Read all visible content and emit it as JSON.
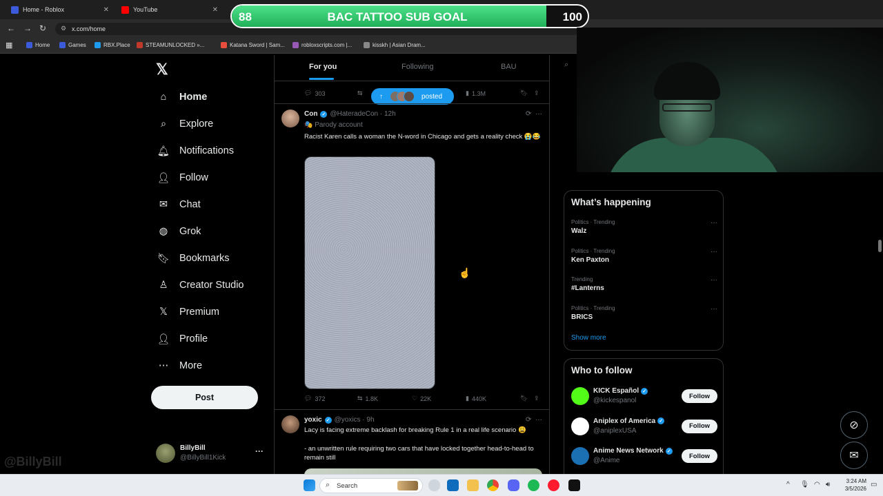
{
  "browser": {
    "tabs": [
      {
        "title": "Home - Roblox",
        "color": "#3b5bdb"
      },
      {
        "title": "YouTube",
        "color": "#ff0000"
      }
    ],
    "url": "x.com/home",
    "bookmarks": [
      {
        "label": "Home",
        "color": "#3b5bdb"
      },
      {
        "label": "Games",
        "color": "#3b5bdb"
      },
      {
        "label": "RBX.Place",
        "color": "#1d9bf0"
      },
      {
        "label": "STEAMUNLOCKED »...",
        "color": "#c0392b"
      },
      {
        "label": "Katana Sword | Sam...",
        "color": "#e74c3c"
      },
      {
        "label": "robloxscripts.com |...",
        "color": "#9b59b6"
      },
      {
        "label": "kisskh | Asian Dram...",
        "color": "#888888"
      }
    ]
  },
  "overlay": {
    "goal_current": "88",
    "goal_title": "BAC TATTOO SUB GOAL",
    "goal_target": "100",
    "goal_fraction": 0.88
  },
  "nav": {
    "items": [
      {
        "label": "Home",
        "icon": "home-icon",
        "glyph": "⌂"
      },
      {
        "label": "Explore",
        "icon": "search-icon",
        "glyph": "⌕"
      },
      {
        "label": "Notifications",
        "icon": "bell-icon",
        "glyph": "🔔︎"
      },
      {
        "label": "Follow",
        "icon": "person-plus-icon",
        "glyph": "👤︎"
      },
      {
        "label": "Chat",
        "icon": "mail-icon",
        "glyph": "✉"
      },
      {
        "label": "Grok",
        "icon": "grok-icon",
        "glyph": "◍"
      },
      {
        "label": "Bookmarks",
        "icon": "bookmark-icon",
        "glyph": "🔖︎"
      },
      {
        "label": "Creator Studio",
        "icon": "creator-icon",
        "glyph": "♙"
      },
      {
        "label": "Premium",
        "icon": "x-icon",
        "glyph": "𝕏"
      },
      {
        "label": "Profile",
        "icon": "profile-icon",
        "glyph": "👤︎"
      },
      {
        "label": "More",
        "icon": "more-circle-icon",
        "glyph": "⋯"
      }
    ],
    "post_label": "Post",
    "account_name": "BillyBill",
    "account_handle": "@BillyBill1Kick"
  },
  "timeline": {
    "tabs": [
      "For you",
      "Following",
      "BAU"
    ],
    "prev_stats": {
      "replies": "303",
      "views": "1.3M"
    },
    "posted_label": "posted",
    "tweets": [
      {
        "name": "Con",
        "handle": "@HateradeCon · 12h",
        "parody": "🎭 Parody account",
        "text": "Racist Karen calls a woman the N-word in Chicago and gets a reality check 😭😂",
        "replies": "372",
        "reposts": "1.8K",
        "likes": "22K",
        "views": "440K"
      },
      {
        "name": "yoxic",
        "handle": "@yoxics · 9h",
        "text": "Lacy is facing extreme backlash for breaking Rule 1 in a real life scenario 😩",
        "text2": "- an unwritten rule requiring two cars that have locked together head-to-head to remain still"
      }
    ]
  },
  "trending": {
    "title": "What’s happening",
    "items": [
      {
        "category": "Politics · Trending",
        "name": "Walz"
      },
      {
        "category": "Politics · Trending",
        "name": "Ken Paxton"
      },
      {
        "category": "Trending",
        "name": "#Lanterns"
      },
      {
        "category": "Politics · Trending",
        "name": "BRICS"
      }
    ],
    "show_more": "Show more"
  },
  "who_to_follow": {
    "title": "Who to follow",
    "follow_label": "Follow",
    "items": [
      {
        "name": "KICK Español",
        "handle": "@kickespanol",
        "color": "#53fc18"
      },
      {
        "name": "Aniplex of America",
        "handle": "@aniplexUSA",
        "color": "#ffffff"
      },
      {
        "name": "Anime News Network",
        "handle": "@Anime",
        "color": "#1b6fb3"
      }
    ]
  },
  "taskbar": {
    "search_placeholder": "Search",
    "time": "3:24 AM",
    "date": "3/5/2026"
  },
  "colors": {
    "accent": "#1d9bf0",
    "background": "#000000",
    "text": "#e7e9ea",
    "muted": "#71767b",
    "goal_fill": "#33c46f"
  }
}
